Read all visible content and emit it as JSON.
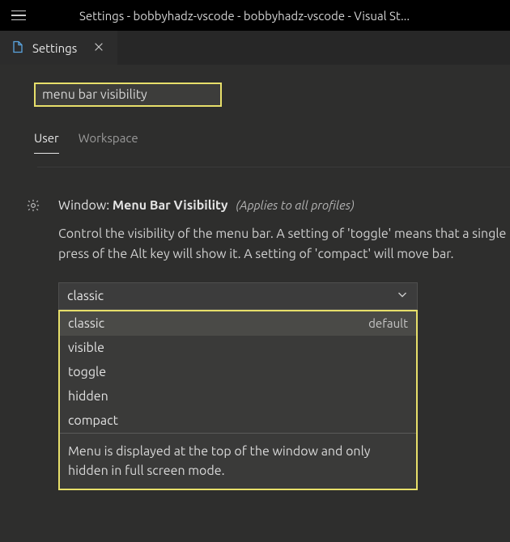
{
  "window": {
    "title": "Settings - bobbyhadz-vscode - bobbyhadz-vscode - Visual St..."
  },
  "tab": {
    "label": "Settings"
  },
  "search": {
    "value": "menu bar visibility"
  },
  "scope": {
    "user": "User",
    "workspace": "Workspace"
  },
  "setting": {
    "prefix": "Window: ",
    "name": "Menu Bar Visibility",
    "applies": "(Applies to all profiles)",
    "description": "Control the visibility of the menu bar. A setting of 'toggle' means that a single press of the Alt key will show it. A setting of 'compact' will move bar.",
    "selected": "classic",
    "options": [
      {
        "label": "classic",
        "default": "default"
      },
      {
        "label": "visible",
        "default": ""
      },
      {
        "label": "toggle",
        "default": ""
      },
      {
        "label": "hidden",
        "default": ""
      },
      {
        "label": "compact",
        "default": ""
      }
    ],
    "option_description": "Menu is displayed at the top of the window and only hidden in full screen mode."
  }
}
